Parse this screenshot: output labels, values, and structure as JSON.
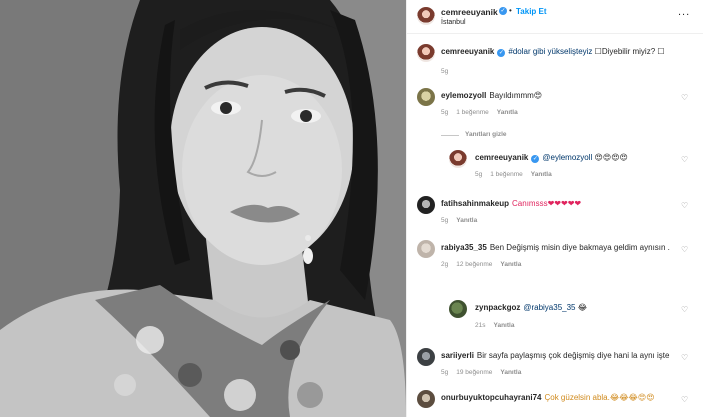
{
  "post": {
    "username": "cemreeuyanik",
    "follow_label": "Takip Et",
    "location": "İstanbul",
    "more_label": "...",
    "caption_tags": "#dolar gibi yükselişteyiz",
    "caption_rest": " ☐Diyebilir miyiz? ☐",
    "caption_time": "5g"
  },
  "comments": [
    {
      "user": "eylemozyoll",
      "text": "Bayıldımmm😍",
      "time": "5g",
      "likes": "1 beğenme",
      "reply": "Yanıtla",
      "hide": "Yanıtları gizle"
    },
    {
      "user": "cemreeuyanik",
      "mention": "@eylemozyoll",
      "text": " 😍😍😍😍",
      "time": "5g",
      "likes": "1 beğenme",
      "reply": "Yanıtla"
    },
    {
      "user": "fatihsahinmakeup",
      "text": "Canımsss❤❤❤❤❤",
      "time": "5g",
      "likes": "",
      "reply": "Yanıtla"
    },
    {
      "user": "rabiya35_35",
      "text": "Ben Değişmiş misin diye bakmaya geldim aynısın .",
      "time": "2g",
      "likes": "12 beğenme",
      "reply": "Yanıtla"
    },
    {
      "user": "zynpackgoz",
      "mention": "@rabiya35_35",
      "text": " 😂",
      "time": "21s",
      "likes": "",
      "reply": "Yanıtla"
    },
    {
      "user": "sariiyerli",
      "text": "Bir sayfa paylaşmış çok değişmiş diye hani la aynı işte",
      "time": "5g",
      "likes": "19 beğenme",
      "reply": "Yanıtla"
    },
    {
      "user": "onurbuyuktopcuhayrani74",
      "text": "Çok güzelsin abla.😂😂😂😍😍",
      "time": "",
      "likes": "",
      "reply": ""
    }
  ],
  "icons": {
    "verified": "verified-badge-icon",
    "like": "heart-outline-icon"
  }
}
